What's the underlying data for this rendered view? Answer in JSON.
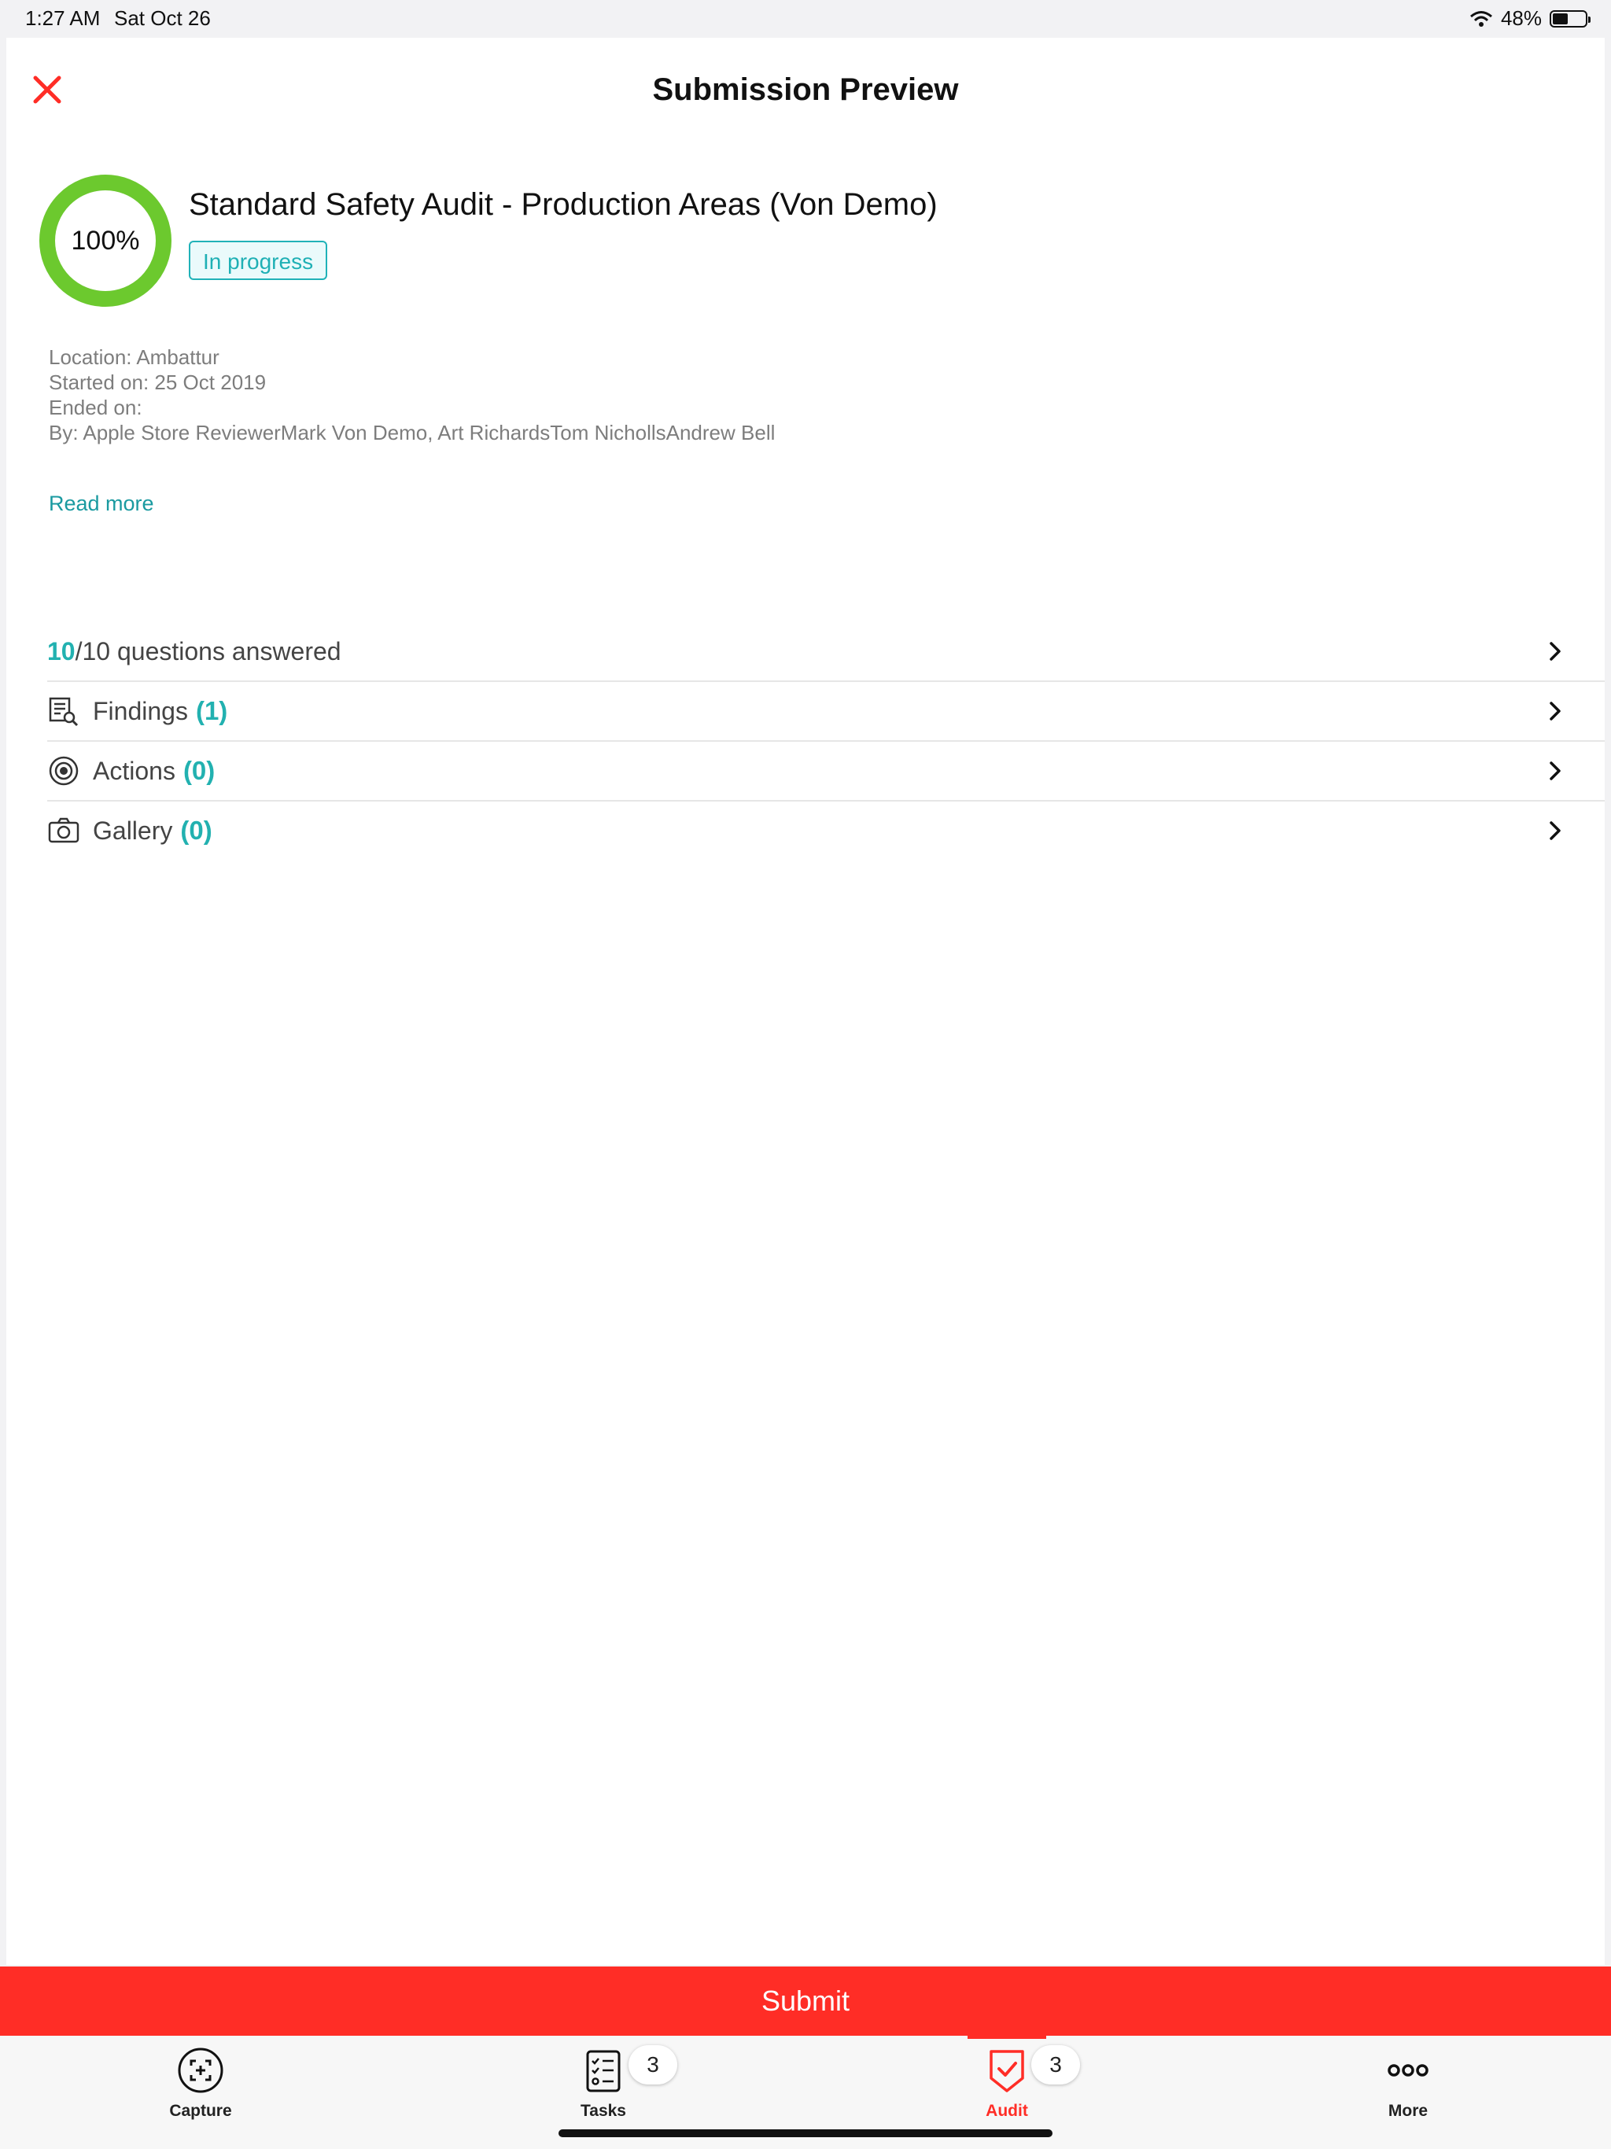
{
  "status_bar": {
    "time": "1:27 AM",
    "date": "Sat Oct 26",
    "battery": "48%",
    "battery_level": 0.48
  },
  "header": {
    "title": "Submission Preview",
    "close_icon": "close-icon",
    "accent_color": "#ff2d26"
  },
  "audit": {
    "progress_label": "100%",
    "progress_value": 1.0,
    "progress_color": "#6cc92e",
    "name": "Standard Safety Audit - Production Areas (Von Demo)",
    "status": "In progress",
    "location": "Location: Ambattur",
    "started": "Started on: 25 Oct 2019",
    "ended": "Ended on:",
    "by": "By: Apple Store ReviewerMark Von Demo, Art RichardsTom NichollsAndrew Bell",
    "read_more": "Read more"
  },
  "summary": {
    "answered": "10",
    "answered_suffix": "/10 questions answered",
    "findings_label": "Findings",
    "findings_count": "(1)",
    "actions_label": "Actions",
    "actions_count": "(0)",
    "gallery_label": "Gallery",
    "gallery_count": "(0)",
    "teal_color": "#22b1b0"
  },
  "submit": {
    "label": "Submit"
  },
  "tab_bar": {
    "tabs": [
      {
        "label": "Capture",
        "icon": "capture-icon"
      },
      {
        "label": "Tasks",
        "icon": "tasks-icon",
        "badge": "3"
      },
      {
        "label": "Audit",
        "icon": "audit-shield-icon",
        "badge": "3",
        "active": true
      },
      {
        "label": "More",
        "icon": "more-icon"
      }
    ]
  }
}
